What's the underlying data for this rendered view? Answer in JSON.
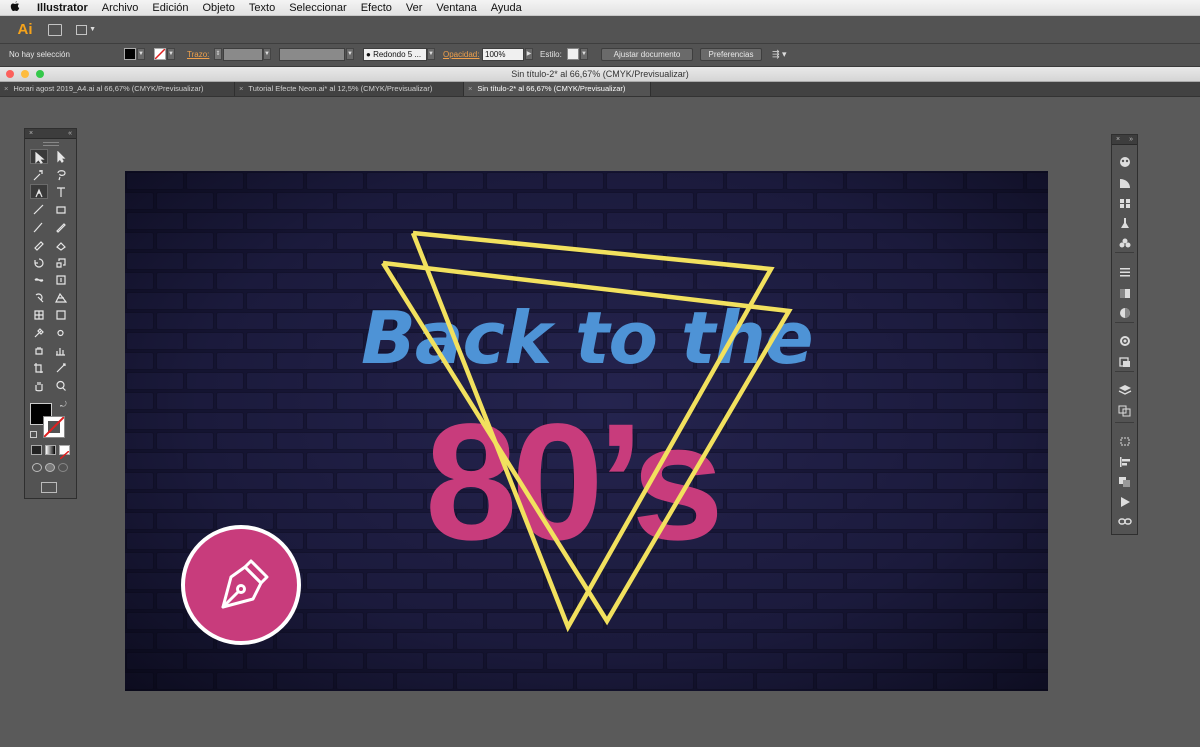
{
  "menubar": {
    "items": [
      "Illustrator",
      "Archivo",
      "Edición",
      "Objeto",
      "Texto",
      "Seleccionar",
      "Efecto",
      "Ver",
      "Ventana",
      "Ayuda"
    ]
  },
  "appbar": {
    "logo": "Ai"
  },
  "controlbar": {
    "selection": "No hay selección",
    "stroke_label": "Trazo:",
    "brush": "Redondo 5 ...",
    "opacity_label": "Opacidad:",
    "opacity_value": "100%",
    "style_label": "Estilo:",
    "adjust_button": "Ajustar documento",
    "prefs_button": "Preferencias"
  },
  "window": {
    "title": "Sin título-2* al 66,67% (CMYK/Previsualizar)"
  },
  "tabs": [
    {
      "label": "Horari agost 2019_A4.ai al 66,67% (CMYK/Previsualizar)"
    },
    {
      "label": "Tutorial Efecte Neon.ai* al 12,5% (CMYK/Previsualizar)"
    },
    {
      "label": "Sin título-2* al 66,67% (CMYK/Previsualizar)"
    }
  ],
  "artwork": {
    "headline": "Back to the",
    "big_text": "80’s",
    "colors": {
      "background": "#1b1a3e",
      "headline": "#4e93d6",
      "big_text": "#c83c7c",
      "neon_triangles": "#f2e15e",
      "badge": "#c83c7c"
    }
  },
  "icons": {
    "tools": [
      "selection-tool",
      "direct-selection-tool",
      "magic-wand-tool",
      "lasso-tool",
      "pen-tool",
      "type-tool",
      "line-tool",
      "rectangle-tool",
      "paintbrush-tool",
      "pencil-tool",
      "blob-brush-tool",
      "eraser-tool",
      "rotate-tool",
      "scale-tool",
      "width-tool",
      "free-transform-tool",
      "shape-builder-tool",
      "perspective-grid-tool",
      "mesh-tool",
      "gradient-tool",
      "eyedropper-tool",
      "blend-tool",
      "symbol-sprayer-tool",
      "column-graph-tool",
      "artboard-tool",
      "slice-tool",
      "hand-tool",
      "zoom-tool"
    ],
    "dock": [
      "color-icon",
      "color-guide-icon",
      "swatches-icon",
      "brushes-icon",
      "symbols-icon",
      "stroke-icon",
      "gradient-icon",
      "transparency-icon",
      "appearance-icon",
      "graphic-styles-icon",
      "layers-icon",
      "artboards-icon",
      "transform-icon",
      "align-icon",
      "pathfinder-icon",
      "actions-icon",
      "links-icon"
    ]
  }
}
